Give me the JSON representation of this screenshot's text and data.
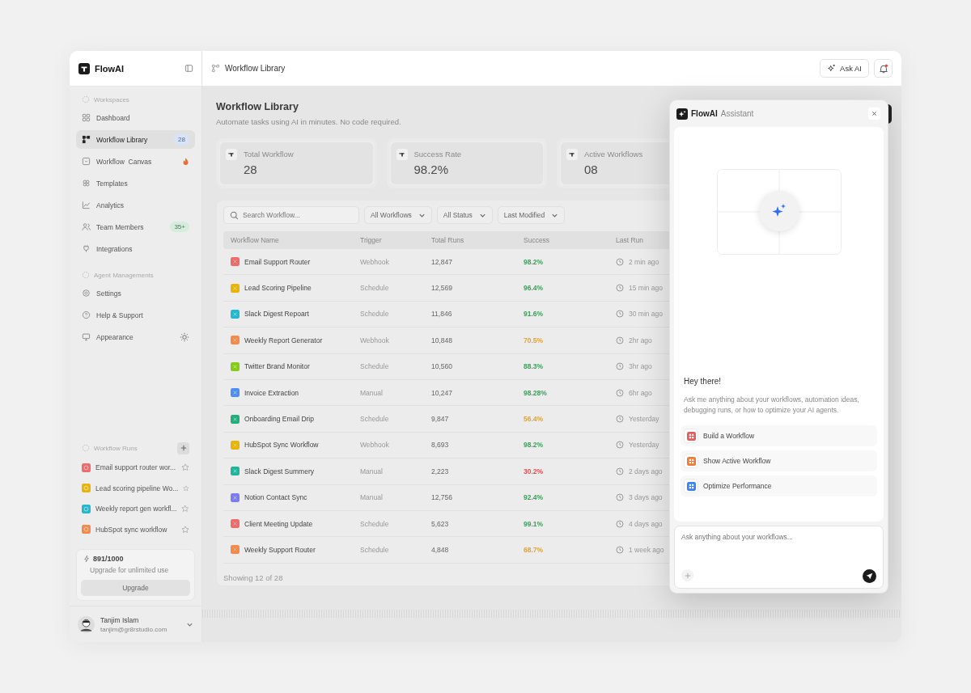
{
  "sidebar": {
    "brand": "FlowAI",
    "sections": [
      {
        "title": "Workspaces",
        "items": [
          {
            "label": "Dashboard",
            "kind": "plain",
            "selected": false
          },
          {
            "label": "Workflow Library",
            "kind": "count",
            "badge": {
              "text": "28",
              "color": "#d6e4fb"
            },
            "selected": true
          },
          {
            "label": "Workflow  Canvas",
            "kind": "fire",
            "selected": false
          },
          {
            "label": "Templates",
            "kind": "plain",
            "selected": false
          },
          {
            "label": "Analytics",
            "kind": "plain",
            "selected": false
          },
          {
            "label": "Team Members",
            "kind": "count",
            "badge": {
              "text": "35+",
              "color": "#d3eedb"
            },
            "selected": false
          },
          {
            "label": "Integrations",
            "kind": "plain",
            "selected": false
          }
        ]
      },
      {
        "title": "Agent Managements",
        "items": [
          {
            "label": "Settings",
            "kind": "plain",
            "selected": false
          },
          {
            "label": "Help & Support",
            "kind": "plain",
            "selected": false
          },
          {
            "label": "Appearance",
            "kind": "theme",
            "selected": false
          }
        ]
      }
    ],
    "runs": {
      "title": "Workflow  Runs",
      "items": [
        {
          "label": "Email support router wor...",
          "color": "#ef6b6b"
        },
        {
          "label": "Lead scoring pipeline Wo...",
          "color": "#eab308"
        },
        {
          "label": "Weekly report gen workfl...",
          "color": "#22b8cf"
        },
        {
          "label": "HubSpot sync workflow",
          "color": "#f5894a"
        }
      ]
    },
    "usage": {
      "count": "891/1000",
      "note": "Upgrade for unlimited use",
      "button": "Upgrade"
    },
    "user": {
      "name": "Tanjim Islam",
      "email": "tanjim@gr8rstudio.com"
    }
  },
  "topbar": {
    "title": "Workflow Library",
    "ask_button": "Ask AI",
    "unread": true
  },
  "page": {
    "title": "Workflow Library",
    "subtitle": "Automate tasks using AI in minutes. No code required.",
    "stats": [
      {
        "label": "Total Workflow",
        "value": "28"
      },
      {
        "label": "Success Rate",
        "value": "98.2%"
      },
      {
        "label": "Active Workflows",
        "value": "08"
      }
    ]
  },
  "filters": {
    "search_placeholder": "Search Workflow...",
    "dropdowns": [
      "All Workflows",
      "All Status",
      "Last Modified"
    ]
  },
  "table": {
    "columns": [
      "Workflow Name",
      "Trigger",
      "Total Runs",
      "Success",
      "Last Run"
    ],
    "rows": [
      {
        "name": "Email Support Router",
        "trigger": "Webhook",
        "runs": "12,847",
        "success": {
          "text": "98.2%",
          "color": "#3f9d5c"
        },
        "last_run": "2 min ago",
        "color": "#ef6b6b"
      },
      {
        "name": "Lead Scoring Pipeline",
        "trigger": "Schedule",
        "runs": "12,569",
        "success": {
          "text": "96.4%",
          "color": "#3f9d5c"
        },
        "last_run": "15 min ago",
        "color": "#eab308"
      },
      {
        "name": "Slack Digest Repoart",
        "trigger": "Schedule",
        "runs": "11,846",
        "success": {
          "text": "91.6%",
          "color": "#3f9d5c"
        },
        "last_run": "30 min ago",
        "color": "#22b8cf"
      },
      {
        "name": "Weekly Report Generator",
        "trigger": "Webhook",
        "runs": "10,848",
        "success": {
          "text": "70.5%",
          "color": "#d9a441"
        },
        "last_run": "2hr ago",
        "color": "#f5894a"
      },
      {
        "name": "Twitter Brand Monitor",
        "trigger": "Schedule",
        "runs": "10,560",
        "success": {
          "text": "88.3%",
          "color": "#3f9d5c"
        },
        "last_run": "3hr ago",
        "color": "#84cc16"
      },
      {
        "name": "Invoice Extraction",
        "trigger": "Manual",
        "runs": "10,247",
        "success": {
          "text": "98.28%",
          "color": "#3f9d5c"
        },
        "last_run": "6hr ago",
        "color": "#4f8ef7"
      },
      {
        "name": "Onboarding Email Drip",
        "trigger": "Schedule",
        "runs": "9,847",
        "success": {
          "text": "56.4%",
          "color": "#d9a441"
        },
        "last_run": "Yesterday",
        "color": "#22b07a"
      },
      {
        "name": "HubSpot Sync Workflow",
        "trigger": "Webhook",
        "runs": "8,693",
        "success": {
          "text": "98.2%",
          "color": "#3f9d5c"
        },
        "last_run": "Yesterday",
        "color": "#eab308"
      },
      {
        "name": "Slack Digest Summery",
        "trigger": "Manual",
        "runs": "2,223",
        "success": {
          "text": "30.2%",
          "color": "#e05252"
        },
        "last_run": "2 days ago",
        "color": "#1fb59a"
      },
      {
        "name": "Notion Contact Sync",
        "trigger": "Manual",
        "runs": "12,756",
        "success": {
          "text": "92.4%",
          "color": "#3f9d5c"
        },
        "last_run": "3 days ago",
        "color": "#7c7cf2"
      },
      {
        "name": "Client Meeting Update",
        "trigger": "Schedule",
        "runs": "5,623",
        "success": {
          "text": "99.1%",
          "color": "#3f9d5c"
        },
        "last_run": "4 days ago",
        "color": "#ef6b6b"
      },
      {
        "name": "Weekly Support Router",
        "trigger": "Schedule",
        "runs": "4,848",
        "success": {
          "text": "68.7%",
          "color": "#d9a441"
        },
        "last_run": "1 week ago",
        "color": "#f5894a"
      }
    ],
    "footer": "Showing 12 of 28"
  },
  "assistant": {
    "brand": "FlowAI",
    "title": "Assistant",
    "greeting": "Hey there!",
    "message": "Ask me anything about your workflows, automation ideas, debugging runs, or how to optimize your AI agents.",
    "suggestions": [
      {
        "label": "Build a Workflow",
        "color": "#e35d5d"
      },
      {
        "label": "Show Active Workflow",
        "color": "#f07a3a"
      },
      {
        "label": "Optimize Performance",
        "color": "#3b82f6"
      }
    ],
    "input_placeholder": "Ask anything about your workflows..."
  }
}
